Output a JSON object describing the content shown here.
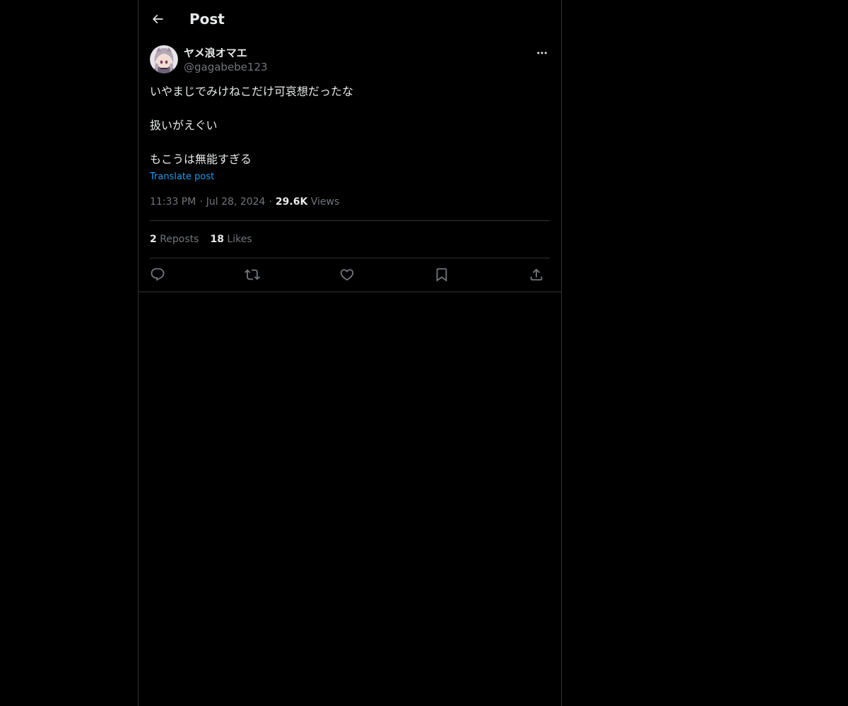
{
  "header": {
    "title": "Post",
    "back_icon": "arrow-left-icon"
  },
  "author": {
    "display_name": "ヤメ浪オマエ",
    "handle": "@gagabebe123",
    "avatar_icon": "avatar-image"
  },
  "post": {
    "lines": [
      "いやまじでみけねこだけ可哀想だったな",
      "扱いがえぐい",
      "もこうは無能すぎる"
    ],
    "translate_label": "Translate post",
    "time": "11:33 PM",
    "date": "Jul 28, 2024",
    "separator": "·",
    "views_count": "29.6K",
    "views_label": "Views"
  },
  "stats": {
    "reposts_count": "2",
    "reposts_label": "Reposts",
    "likes_count": "18",
    "likes_label": "Likes"
  },
  "actions": [
    {
      "icon": "reply-icon"
    },
    {
      "icon": "repost-icon"
    },
    {
      "icon": "like-icon"
    },
    {
      "icon": "bookmark-icon"
    },
    {
      "icon": "share-icon"
    }
  ],
  "colors": {
    "background": "#000000",
    "text_primary": "#e7e9ea",
    "text_secondary": "#71767b",
    "link": "#1d9bf0",
    "border": "#2f3336"
  }
}
